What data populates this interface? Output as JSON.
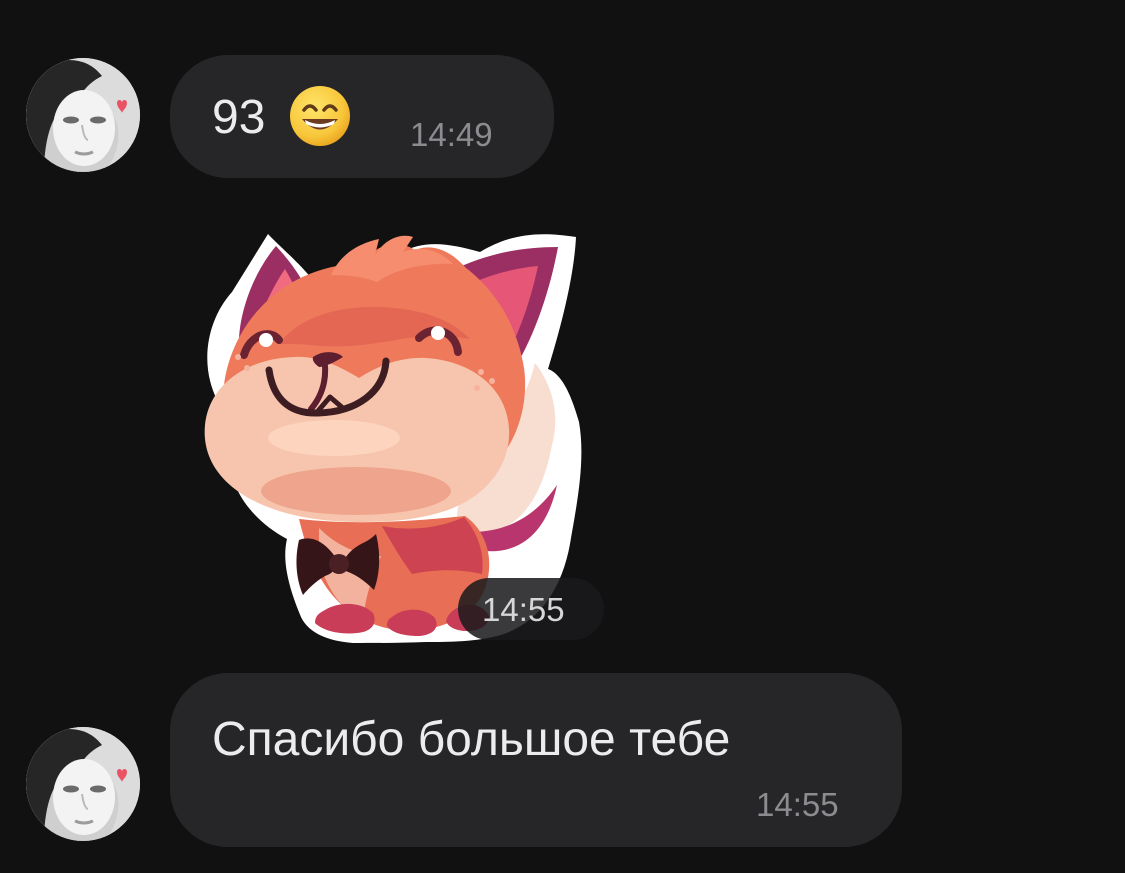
{
  "chat": {
    "messages": [
      {
        "type": "text",
        "text": "93",
        "emoji": "grinning-face-with-smiling-eyes",
        "time": "14:49"
      },
      {
        "type": "sticker",
        "sticker": "fox-with-bow-tie-sticker",
        "time": "14:55"
      },
      {
        "type": "text",
        "text": "Спасибо большое тебе",
        "time": "14:55"
      }
    ]
  },
  "colors": {
    "background": "#111112",
    "bubble": "#262628",
    "text": "#ececee",
    "time": "#8c8c90",
    "sticker_fox": "#ef7a5b",
    "sticker_ears": "#9b2f63",
    "sticker_muzzle": "#f7c5ad"
  },
  "avatars": [
    {
      "icon": "user-avatar-icon"
    },
    {
      "icon": "user-avatar-icon"
    }
  ]
}
